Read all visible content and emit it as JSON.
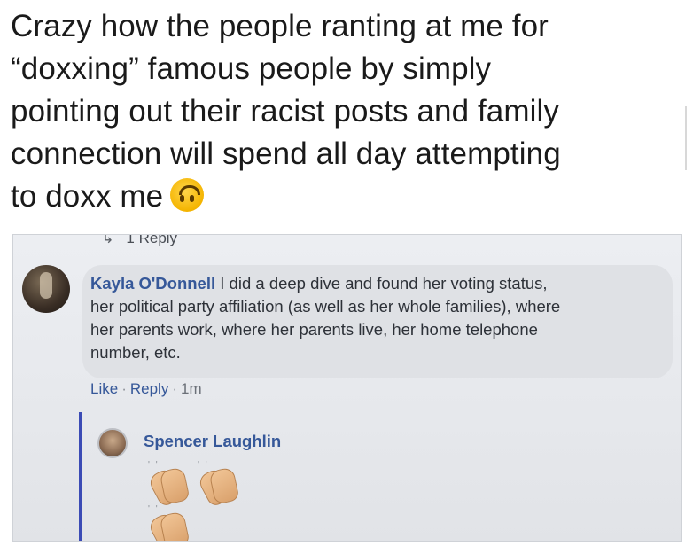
{
  "tweet": {
    "lines": [
      "Crazy how the people ranting at me for",
      "“doxxing” famous people by simply",
      "pointing out their racist posts and family",
      "connection will spend all day attempting",
      "to doxx me"
    ],
    "emoji": "upside-down-face"
  },
  "photo": {
    "reply_link": "1 Reply",
    "comment": {
      "author": "Kayla O'Donnell",
      "text": "I did a deep dive and found her voting status, her political party affiliation (as well as her whole families), where her parents work, where her parents live, her home telephone number, etc.",
      "lines": [
        " I did a deep dive and found her voting status,",
        "her political party affiliation (as well as her whole families), where",
        "her parents work, where her parents live, her home telephone",
        "number, etc."
      ],
      "actions": {
        "like": "Like",
        "reply": "Reply",
        "time": "1m",
        "separator": "·"
      }
    },
    "reply": {
      "author": "Spencer Laughlin",
      "content_icons": [
        "clapping-hands",
        "clapping-hands",
        "clapping-hands"
      ]
    }
  },
  "colors": {
    "link_blue": "#365899",
    "thread_line": "#3b4bb5",
    "bubble": "#dfe1e5"
  }
}
